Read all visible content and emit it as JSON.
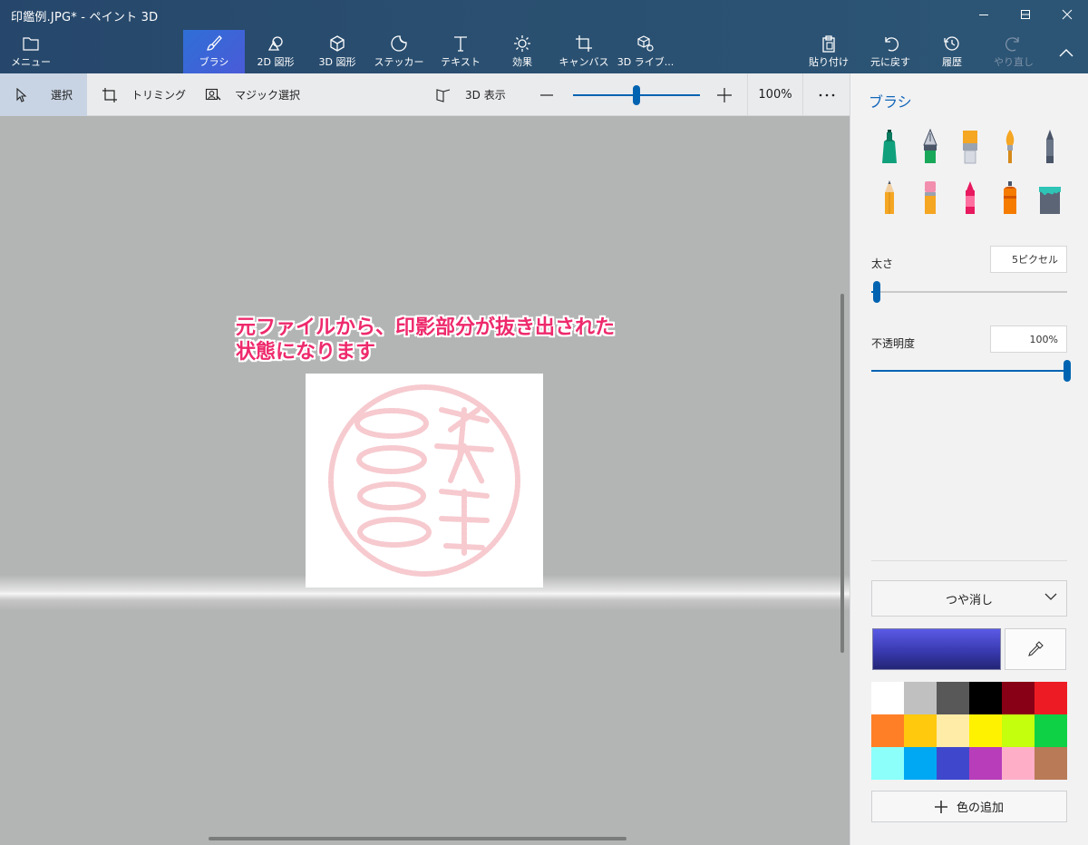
{
  "window": {
    "title": "印鑑例.JPG* - ペイント 3D"
  },
  "ribbon": {
    "menu_label": "メニュー",
    "tools": [
      {
        "label": "ブラシ",
        "icon": "brush-icon",
        "active": true
      },
      {
        "label": "2D 図形",
        "icon": "2d-shapes-icon"
      },
      {
        "label": "3D 図形",
        "icon": "3d-shapes-icon"
      },
      {
        "label": "ステッカー",
        "icon": "sticker-icon"
      },
      {
        "label": "テキスト",
        "icon": "text-icon"
      },
      {
        "label": "効果",
        "icon": "effects-icon"
      },
      {
        "label": "キャンバス",
        "icon": "canvas-icon"
      },
      {
        "label": "3D ライブ...",
        "icon": "3d-library-icon"
      }
    ],
    "right_tools": [
      {
        "label": "貼り付け",
        "icon": "paste-icon"
      },
      {
        "label": "元に戻す",
        "icon": "undo-icon"
      },
      {
        "label": "履歴",
        "icon": "history-icon"
      },
      {
        "label": "やり直し",
        "icon": "redo-icon",
        "disabled": true
      }
    ]
  },
  "subbar": {
    "select_label": "選択",
    "crop_label": "トリミング",
    "magic_select_label": "マジック選択",
    "view3d_label": "3D 表示",
    "zoom_level": "100%",
    "zoom_fraction": 0.5
  },
  "canvas": {
    "annotation_line1": "元ファイルから、印影部分が抜き出された",
    "annotation_line2": "状態になります"
  },
  "panel": {
    "title": "ブラシ",
    "brushes": [
      "marker-icon",
      "calligraphy-pen-icon",
      "oil-brush-icon",
      "watercolor-icon",
      "pixel-pen-icon",
      "pencil-icon",
      "eraser-icon",
      "crayon-icon",
      "spray-can-icon",
      "fill-bucket-icon"
    ],
    "thickness_label": "太さ",
    "thickness_value": "5ピクセル",
    "thickness_fraction": 0.03,
    "opacity_label": "不透明度",
    "opacity_value": "100%",
    "opacity_fraction": 1.0,
    "finish_value": "つや消し",
    "current_color": "#3f40c0",
    "palette": [
      "#ffffff",
      "#c0c0c0",
      "#585858",
      "#000000",
      "#880015",
      "#ed1c24",
      "#ff7f27",
      "#ffc90e",
      "#ffeca7",
      "#fff200",
      "#c4ff0e",
      "#0ed145",
      "#8cfffb",
      "#00a8f3",
      "#3f48cc",
      "#b83dba",
      "#ffaec8",
      "#b97a57"
    ],
    "add_color_label": "色の追加"
  }
}
